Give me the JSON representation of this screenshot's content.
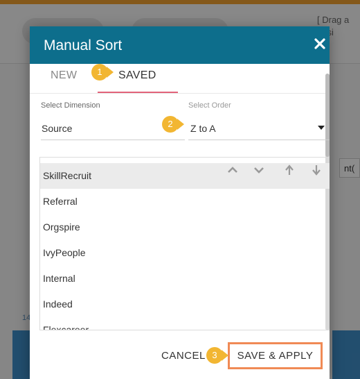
{
  "background": {
    "drag_hint": "[ Drag a",
    "drag_hint2": "ensi",
    "side_text": "nt(",
    "axis_number": "14"
  },
  "modal": {
    "title": "Manual Sort",
    "close_icon": "close-icon",
    "tabs": [
      {
        "label": "NEW",
        "active": false
      },
      {
        "label": "SAVED",
        "active": true
      }
    ],
    "select_dimension": {
      "label": "Select Dimension",
      "value": "Source"
    },
    "select_order": {
      "label": "Select Order",
      "value": "Z to A"
    },
    "list_items": [
      "SkillRecruit",
      "Referral",
      "Orgspire",
      "IvyPeople",
      "Internal",
      "Indeed",
      "Flexcareer"
    ],
    "sort_icons": [
      "chevron-up-icon",
      "chevron-down-icon",
      "arrow-up-icon",
      "arrow-down-icon"
    ],
    "cancel_label": "CANCEL",
    "save_label": "SAVE & APPLY"
  },
  "callouts": [
    "1",
    "2",
    "3"
  ],
  "colors": {
    "header": "#0d6e8c",
    "tab_underline": "#e2637a",
    "callout": "#f2b632",
    "save_border": "#f08a55"
  }
}
